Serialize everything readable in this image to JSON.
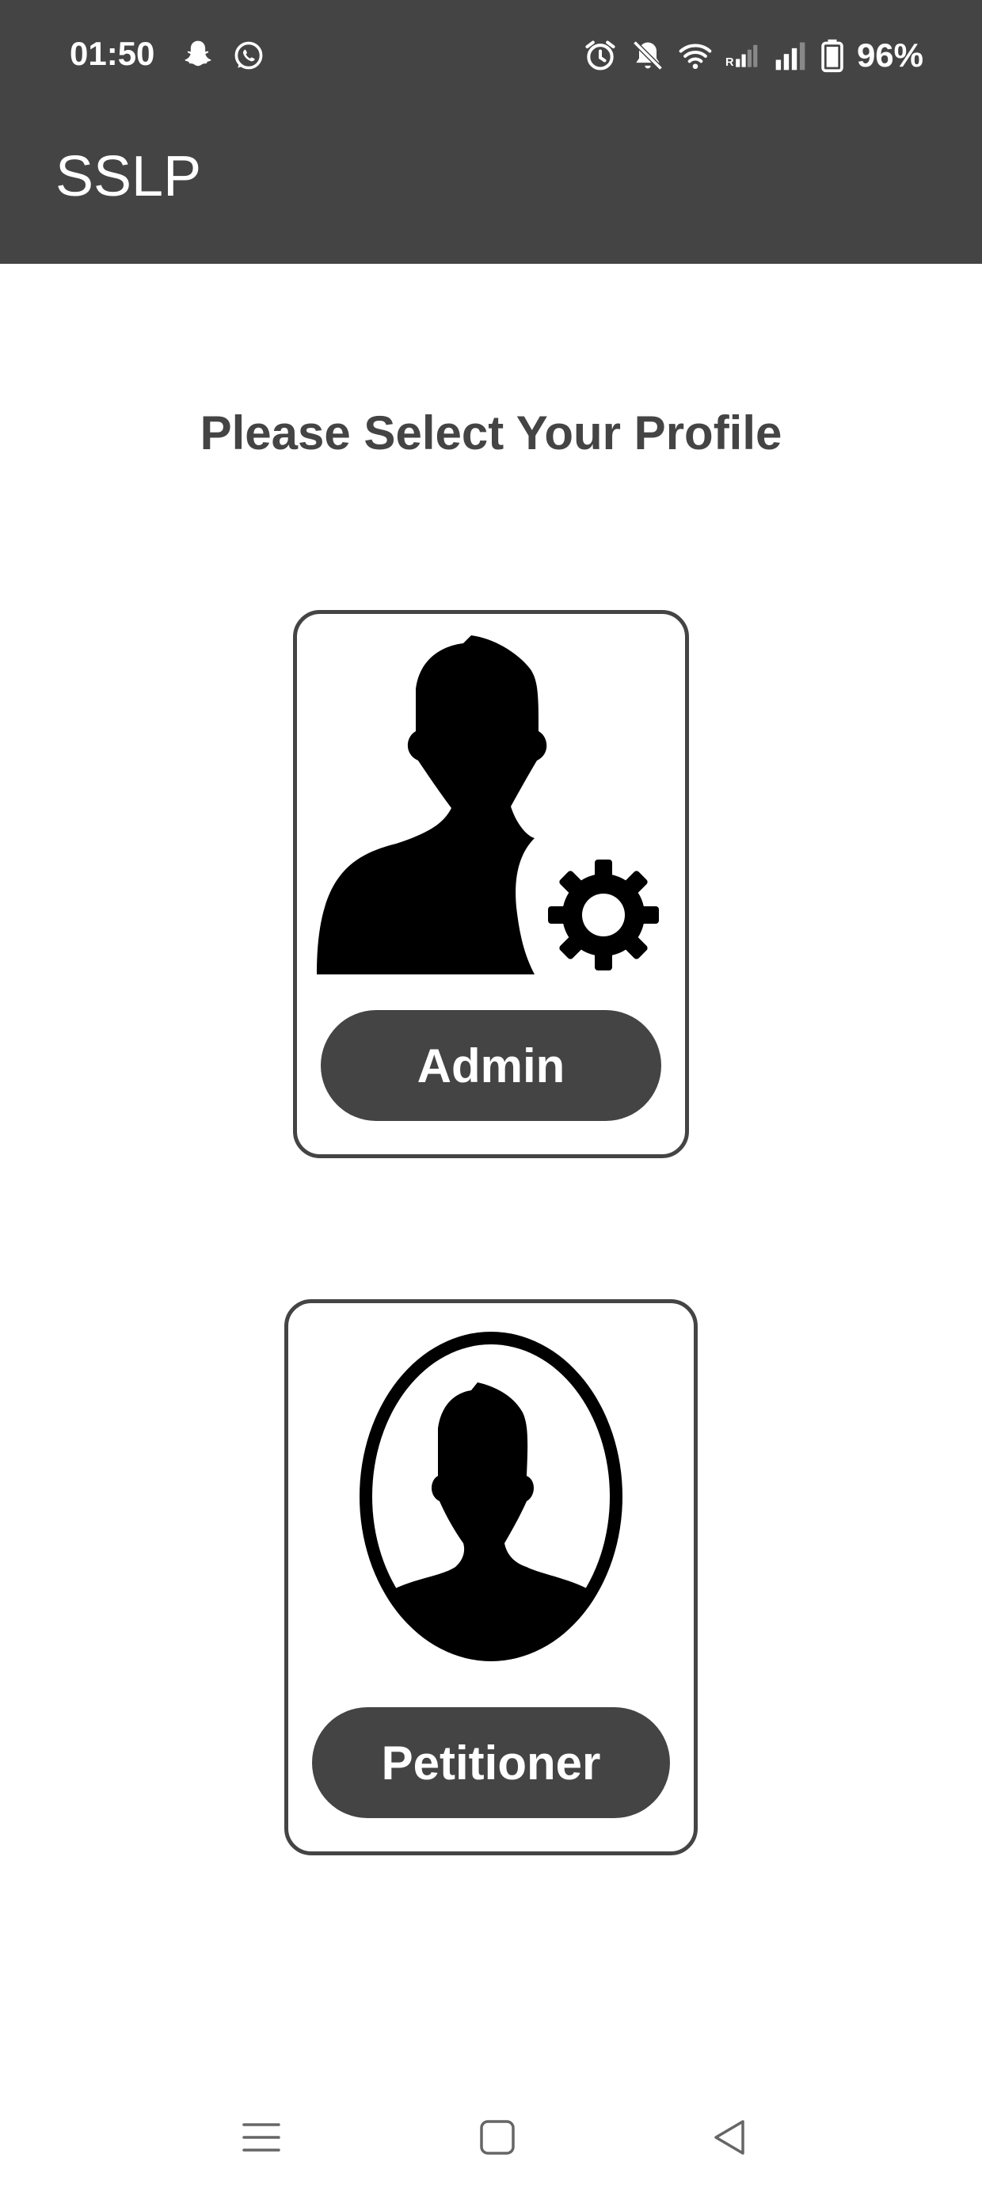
{
  "status_bar": {
    "time": "01:50",
    "battery": "96%",
    "left_icons": [
      "snapchat-icon",
      "whatsapp-icon"
    ],
    "right_icons": [
      "alarm-icon",
      "mute-icon",
      "wifi-icon",
      "signal-icon",
      "signal-icon",
      "battery-icon"
    ]
  },
  "app_bar": {
    "title": "SSLP"
  },
  "main": {
    "prompt": "Please Select Your Profile",
    "profiles": [
      {
        "label": "Admin",
        "icon": "admin-user-gear-icon"
      },
      {
        "label": "Petitioner",
        "icon": "petitioner-portrait-icon"
      }
    ]
  },
  "nav_bar": {
    "buttons": [
      "recents-icon",
      "home-icon",
      "back-icon"
    ]
  },
  "colors": {
    "primary": "#444444",
    "background": "#ffffff",
    "text_on_primary": "#ffffff"
  }
}
